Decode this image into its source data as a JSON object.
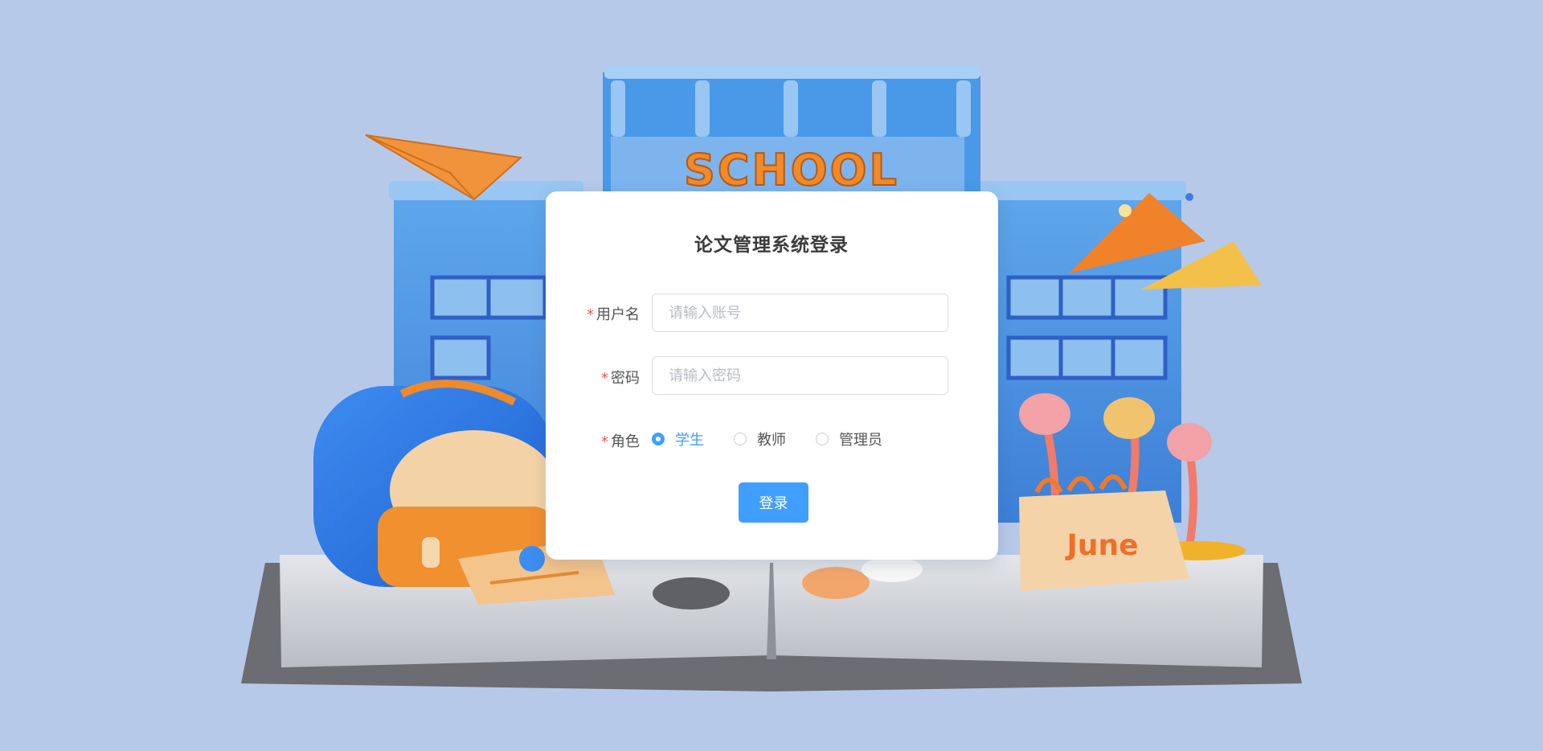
{
  "scene": {
    "sign_text": "SCHOOL",
    "calendar_text": "June"
  },
  "login": {
    "title": "论文管理系统登录",
    "required_mark": "*",
    "username": {
      "label": "用户名",
      "placeholder": "请输入账号",
      "value": ""
    },
    "password": {
      "label": "密码",
      "placeholder": "请输入密码",
      "value": ""
    },
    "role": {
      "label": "角色",
      "options": [
        "学生",
        "教师",
        "管理员"
      ],
      "selected": "学生"
    },
    "submit_label": "登录"
  },
  "colors": {
    "background": "#b7c9e8",
    "primary": "#409eff",
    "required": "#f05656"
  }
}
